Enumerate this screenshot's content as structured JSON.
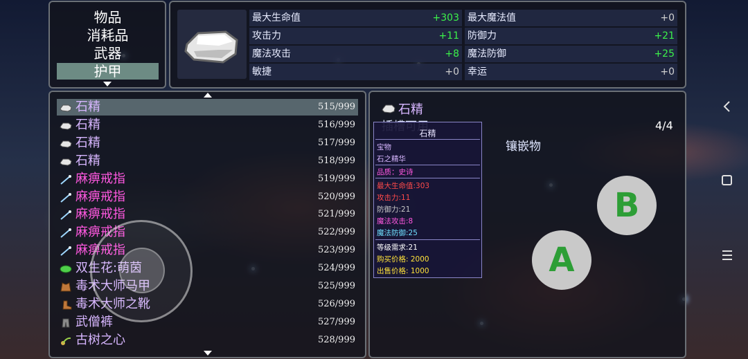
{
  "categories": [
    "物品",
    "消耗品",
    "武器",
    "护甲"
  ],
  "stats": [
    {
      "label": "最大生命值",
      "value": "+303",
      "color": "green"
    },
    {
      "label": "最大魔法值",
      "value": "+0",
      "color": "gray"
    },
    {
      "label": "攻击力",
      "value": "+11",
      "color": "green"
    },
    {
      "label": "防御力",
      "value": "+21",
      "color": "green"
    },
    {
      "label": "魔法攻击",
      "value": "+8",
      "color": "green"
    },
    {
      "label": "魔法防御",
      "value": "+25",
      "color": "green"
    },
    {
      "label": "敏捷",
      "value": "+0",
      "color": "gray"
    },
    {
      "label": "幸运",
      "value": "+0",
      "color": "gray"
    }
  ],
  "items": [
    {
      "name": "石精",
      "count": "515/999",
      "color": "purple",
      "icon": "stone-icon"
    },
    {
      "name": "石精",
      "count": "516/999",
      "color": "purple",
      "icon": "stone-icon"
    },
    {
      "name": "石精",
      "count": "517/999",
      "color": "purple",
      "icon": "stone-icon"
    },
    {
      "name": "石精",
      "count": "518/999",
      "color": "purple",
      "icon": "stone-icon"
    },
    {
      "name": "麻痹戒指",
      "count": "519/999",
      "color": "magenta",
      "icon": "wand-icon"
    },
    {
      "name": "麻痹戒指",
      "count": "520/999",
      "color": "magenta",
      "icon": "wand-icon"
    },
    {
      "name": "麻痹戒指",
      "count": "521/999",
      "color": "magenta",
      "icon": "wand-icon"
    },
    {
      "name": "麻痹戒指",
      "count": "522/999",
      "color": "magenta",
      "icon": "wand-icon"
    },
    {
      "name": "麻痹戒指",
      "count": "523/999",
      "color": "magenta",
      "icon": "wand-icon"
    },
    {
      "name": "双生花:萌茵",
      "count": "524/999",
      "color": "purple",
      "icon": "leaf-icon"
    },
    {
      "name": "毒术大师马甲",
      "count": "525/999",
      "color": "purple",
      "icon": "vest-icon"
    },
    {
      "name": "毒术大师之靴",
      "count": "526/999",
      "color": "purple",
      "icon": "boot-icon"
    },
    {
      "name": "武僧裤",
      "count": "527/999",
      "color": "purple",
      "icon": "pants-icon"
    },
    {
      "name": "古树之心",
      "count": "528/999",
      "color": "purple",
      "icon": "heart-icon"
    }
  ],
  "detail": {
    "name": "石精",
    "socket_label": "插槽可用",
    "page": "4/4",
    "inlay_label": "镶嵌物"
  },
  "tooltip": {
    "title": "石精",
    "type": "宝物",
    "subtype": "石之精华",
    "quality": "品质：史诗",
    "hp": "最大生命值:303",
    "atk": "攻击力:11",
    "def": "防御力:21",
    "matk": "魔法攻击:8",
    "mdef": "魔法防御:25",
    "level": "等级需求:21",
    "buy": "购买价格:  2000",
    "sell": "出售价格:  1000"
  },
  "controls": {
    "a_label": "A",
    "b_label": "B"
  },
  "colors": {
    "selected_row": "#6d8b84",
    "stat_positive": "#3cf24a",
    "epic": "#ff58e0",
    "item_name": "#d7b6ff"
  }
}
